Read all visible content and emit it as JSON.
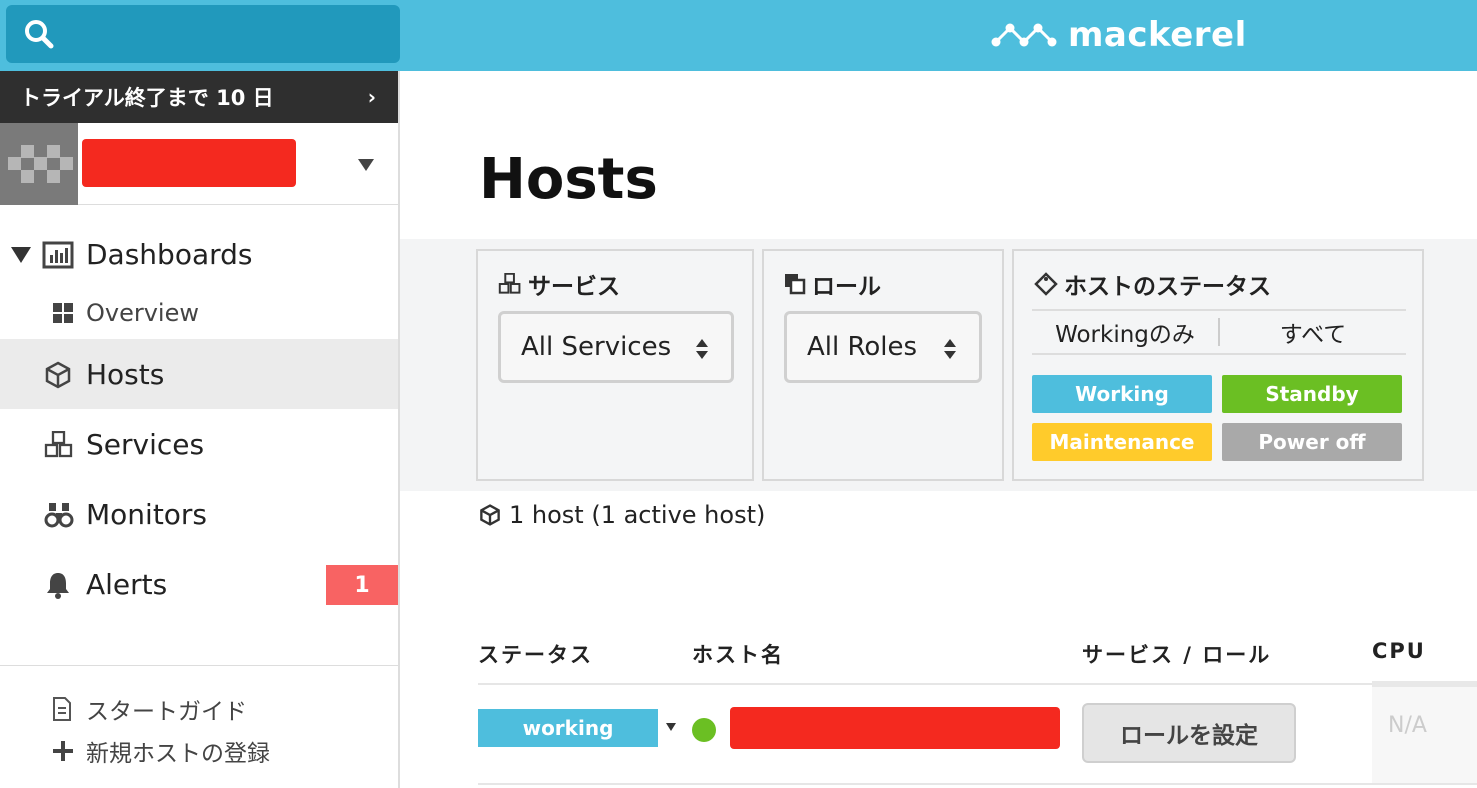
{
  "app": {
    "brand": "mackerel"
  },
  "sidebar": {
    "trial_text": "トライアル終了まで 10 日",
    "trial_chevron": "›",
    "dashboards_label": "Dashboards",
    "overview_label": "Overview",
    "items": [
      {
        "label": "Hosts",
        "icon": "box-icon",
        "active": true
      },
      {
        "label": "Services",
        "icon": "boxes-icon"
      },
      {
        "label": "Monitors",
        "icon": "binoculars-icon"
      },
      {
        "label": "Alerts",
        "icon": "bell-icon",
        "badge": "1"
      }
    ],
    "footer": {
      "start_guide": "スタートガイド",
      "add_host": "新規ホストの登録"
    }
  },
  "main": {
    "title": "Hosts",
    "filters": {
      "service_title": "サービス",
      "service_value": "All Services",
      "role_title": "ロール",
      "role_value": "All Roles",
      "status_title": "ホストのステータス",
      "seg_working_only": "Workingのみ",
      "seg_all": "すべて",
      "statuses": [
        {
          "label": "Working",
          "color": "#4ebedd"
        },
        {
          "label": "Standby",
          "color": "#6bbf23"
        },
        {
          "label": "Maintenance",
          "color": "#ffcb2b"
        },
        {
          "label": "Power off",
          "color": "#a9a9a9"
        }
      ]
    },
    "host_count": "1 host (1 active host)",
    "table": {
      "headers": [
        "ステータス",
        "ホスト名",
        "サービス / ロール",
        "CPU"
      ],
      "rows": [
        {
          "status": "working",
          "status_color": "#4ebedd",
          "dot_color": "#6bbf23",
          "role_button": "ロールを設定",
          "cpu": "N/A"
        }
      ]
    }
  }
}
